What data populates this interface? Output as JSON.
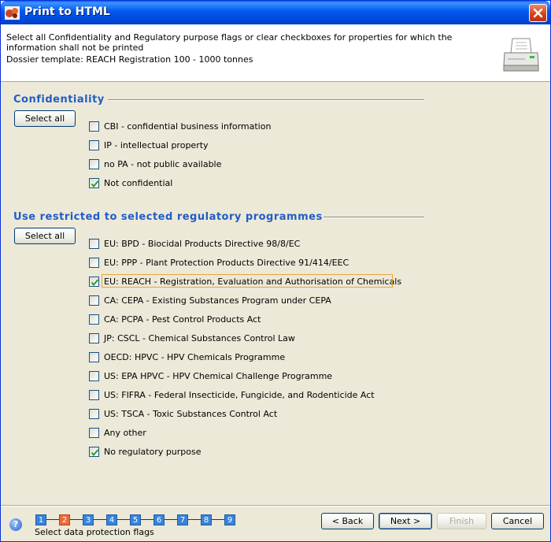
{
  "window": {
    "title": "Print to HTML"
  },
  "header": {
    "instruction": "Select all Confidentiality and Regulatory purpose flags or clear checkboxes for properties for which the information shall not be printed",
    "template_line": "Dossier template: REACH Registration 100 - 1000 tonnes"
  },
  "confidentiality": {
    "title": "Confidentiality",
    "select_all": "Select all",
    "items": [
      {
        "label": "CBI - confidential business information",
        "checked": false
      },
      {
        "label": "IP - intellectual property",
        "checked": false
      },
      {
        "label": "no PA - not public available",
        "checked": false
      },
      {
        "label": "Not confidential",
        "checked": true
      }
    ]
  },
  "regulatory": {
    "title": "Use restricted to selected regulatory programmes",
    "select_all": "Select all",
    "items": [
      {
        "label": "EU: BPD - Biocidal Products Directive 98/8/EC",
        "checked": false
      },
      {
        "label": "EU: PPP - Plant Protection Products Directive 91/414/EEC",
        "checked": false
      },
      {
        "label": "EU: REACH - Registration, Evaluation and Authorisation of Chemicals",
        "checked": true
      },
      {
        "label": "CA: CEPA - Existing Substances Program under CEPA",
        "checked": false
      },
      {
        "label": "CA: PCPA - Pest Control Products Act",
        "checked": false
      },
      {
        "label": "JP: CSCL - Chemical Substances Control Law",
        "checked": false
      },
      {
        "label": "OECD: HPVC - HPV Chemicals Programme",
        "checked": false
      },
      {
        "label": "US: EPA HPVC - HPV Chemical Challenge Programme",
        "checked": false
      },
      {
        "label": "US: FIFRA - Federal Insecticide, Fungicide, and Rodenticide Act",
        "checked": false
      },
      {
        "label": "US: TSCA - Toxic Substances Control Act",
        "checked": false
      },
      {
        "label": "Any other",
        "checked": false
      },
      {
        "label": "No regulatory purpose",
        "checked": true
      }
    ]
  },
  "wizard": {
    "steps": [
      "1",
      "2",
      "3",
      "4",
      "5",
      "6",
      "7",
      "8",
      "9"
    ],
    "active_step": 2,
    "caption": "Select data protection flags",
    "back": "< Back",
    "next": "Next >",
    "finish": "Finish",
    "cancel": "Cancel"
  },
  "colors": {
    "titlebar": "#0058ee",
    "section_title": "#215dc6",
    "step": "#3a83d8",
    "step_active": "#ec6a3c",
    "check": "#21a121"
  }
}
